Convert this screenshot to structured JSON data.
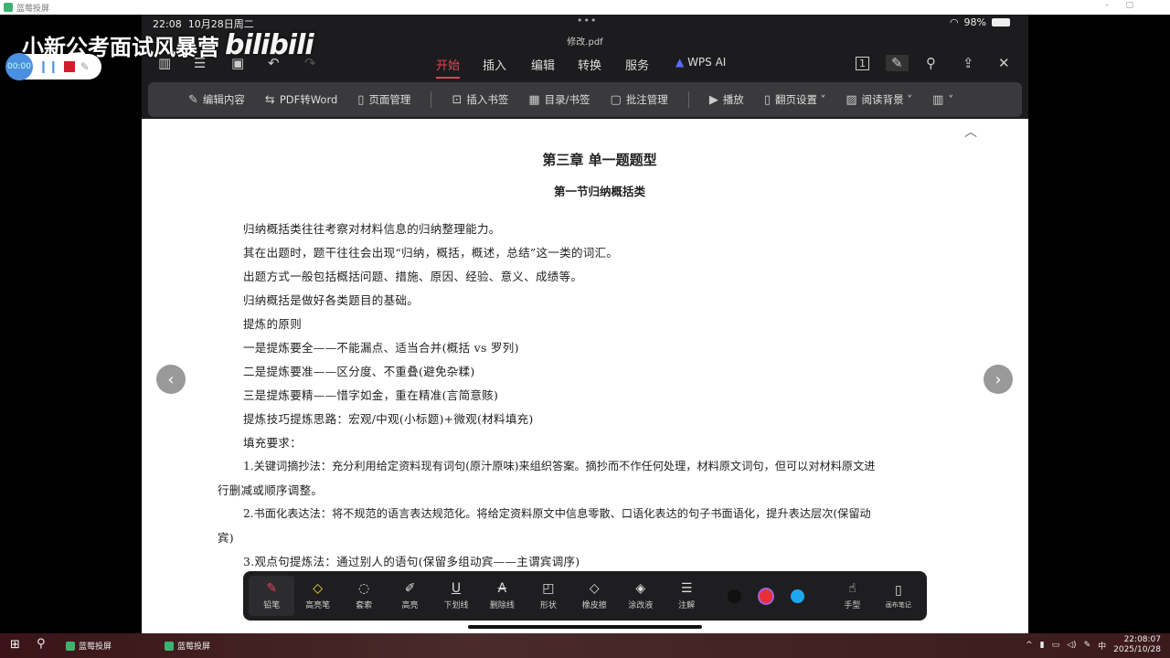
{
  "window": {
    "title": "蓝莓投屏",
    "min": "–",
    "max": "▢"
  },
  "status": {
    "time": "22:08",
    "date": "10月28日周二",
    "battery": "98%",
    "dots": "•••"
  },
  "file": {
    "name": "修改.pdf"
  },
  "topbar": {
    "tabs": [
      "开始",
      "插入",
      "编辑",
      "转换",
      "服务"
    ],
    "ai": "WPS AI",
    "page_num": "1"
  },
  "ribbon": [
    {
      "icon": "✎",
      "label": "编辑内容"
    },
    {
      "icon": "⇆",
      "label": "PDF转Word"
    },
    {
      "icon": "▯",
      "label": "页面管理"
    },
    {
      "icon": "⊡",
      "label": "插入书签"
    },
    {
      "icon": "▦",
      "label": "目录/书签"
    },
    {
      "icon": "▢",
      "label": "批注管理"
    },
    {
      "icon": "▶",
      "label": "播放"
    },
    {
      "icon": "▯",
      "label": "翻页设置 ˅"
    },
    {
      "icon": "▨",
      "label": "阅读背景 ˅"
    },
    {
      "icon": "▥",
      "label": "˅"
    }
  ],
  "doc": {
    "chapter": "第三章 单一题题型",
    "section": "第一节归纳概括类",
    "lines": [
      "归纳概括类往往考察对材料信息的归纳整理能力。",
      "其在出题时，题干往往会出现“归纳，概括，概述，总结”这一类的词汇。",
      "出题方式一般包括概括问题、措施、原因、经验、意义、成绩等。",
      "归纳概括是做好各类题目的基础。",
      "提炼的原则",
      "一是提炼要全——不能漏点、适当合并(概括 vs 罗列)",
      "二是提炼要准——区分度、不重叠(避免杂糅)",
      "三是提炼要精——惜字如金，重在精准(言简意赅)",
      "提炼技巧提炼思路：宏观/中观(小标题)+微观(材料填充)",
      "填充要求：",
      "1.关键词摘抄法：充分利用给定资料现有词句(原汁原味)来组织答案。摘抄而不作任何处理，材料原文词句，但可以对材料原文进",
      "行删减或顺序调整。",
      "2.书面化表达法：将不规范的语言表达规范化。将给定资料原文中信息零散、口语化表达的句子书面语化，提升表达层次(保留动",
      "宾)",
      "3.观点句提炼法：通过别人的语句(保留多组动宾——主谓宾调序)"
    ]
  },
  "annotation_tools": [
    {
      "icon": "✎",
      "label": "铅笔"
    },
    {
      "icon": "◇",
      "label": "高亮笔"
    },
    {
      "icon": "◌",
      "label": "套索"
    },
    {
      "icon": "✐",
      "label": "高亮"
    },
    {
      "icon": "U",
      "label": "下划线"
    },
    {
      "icon": "A",
      "label": "删除线"
    },
    {
      "icon": "◰",
      "label": "形状"
    },
    {
      "icon": "◇",
      "label": "橡皮擦"
    },
    {
      "icon": "◈",
      "label": "涂改液"
    },
    {
      "icon": "☰",
      "label": "注解"
    }
  ],
  "colors": [
    "#111111",
    "#e8303a",
    "#1ea7f0"
  ],
  "extra_tools": [
    {
      "icon": "☝",
      "label": "手型"
    },
    {
      "icon": "▯",
      "label": "画布笔记"
    }
  ],
  "overlay": {
    "brand": "小新公考面试风暴营",
    "logo": "bilibili",
    "rec_time": "00:00"
  },
  "taskbar": {
    "apps": [
      "蓝莓投屏",
      "蓝莓投屏"
    ],
    "ime": "中",
    "time": "22:08:07",
    "date": "2025/10/28"
  }
}
